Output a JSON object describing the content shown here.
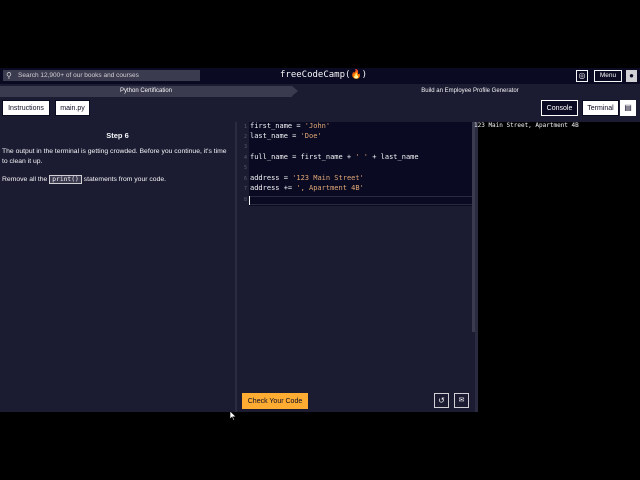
{
  "nav": {
    "search_placeholder": "Search 12,900+ of our books and courses",
    "logo": "freeCodeCamp(🔥)",
    "menu_label": "Menu"
  },
  "breadcrumb": {
    "certification": "Python Certification",
    "project": "Build an Employee Profile Generator"
  },
  "toolbar": {
    "instructions_label": "Instructions",
    "file_label": "main.py",
    "console_label": "Console",
    "terminal_label": "Terminal"
  },
  "instructions": {
    "step": "Step 6",
    "para1": "The output in the terminal is getting crowded. Before you continue, it's time to clean it up.",
    "para2_before": "Remove all the ",
    "para2_code": "print()",
    "para2_after": " statements from your code."
  },
  "editor": {
    "line_numbers": [
      "1",
      "2",
      "3",
      "4",
      "5",
      "6",
      "7",
      "8"
    ],
    "lines": {
      "l1_var": "first_name = ",
      "l1_str": "'John'",
      "l2_var": "last_name = ",
      "l2_str": "'Doe'",
      "l4_a": "full_name = first_name + ",
      "l4_str": "' '",
      "l4_b": " + last_name",
      "l6_var": "address = ",
      "l6_str": "'123 Main Street'",
      "l7_var": "address += ",
      "l7_str": "', Apartment 4B'"
    }
  },
  "actions": {
    "check_label": "Check Your Code"
  },
  "terminal": {
    "output": "123 Main Street, Apartment 4B"
  },
  "colors": {
    "accent": "#feac32",
    "string": "#e2a875",
    "background": "#1b1b32",
    "nav": "#0a0a23"
  }
}
